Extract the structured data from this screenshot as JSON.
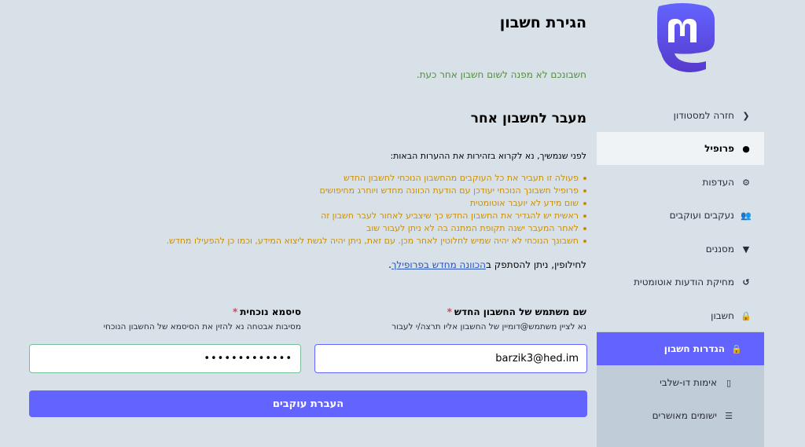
{
  "sidebar": {
    "items": [
      {
        "label": "חזרה למסטודון",
        "icon": "chevron-left-icon",
        "glyph": "❮"
      },
      {
        "label": "פרופיל",
        "icon": "user-icon",
        "glyph": "●"
      },
      {
        "label": "העדפות",
        "icon": "cog-icon",
        "glyph": "⚙"
      },
      {
        "label": "נעקבים ועוקבים",
        "icon": "users-icon",
        "glyph": "👥"
      },
      {
        "label": "מסננים",
        "icon": "filter-icon",
        "glyph": "▼"
      },
      {
        "label": "מחיקת הודעות אוטומטית",
        "icon": "history-icon",
        "glyph": "↺"
      },
      {
        "label": "חשבון",
        "icon": "lock-icon",
        "glyph": "🔒"
      },
      {
        "label": "הגדרות חשבון",
        "icon": "lock-icon",
        "glyph": "🔒"
      },
      {
        "label": "אימות דו-שלבי",
        "icon": "mobile-icon",
        "glyph": "▯"
      },
      {
        "label": "ישומים מאושרים",
        "icon": "list-icon",
        "glyph": "☰"
      }
    ]
  },
  "main": {
    "page_title": "הגירת חשבון",
    "notice": "חשבונכם לא מפנה לשום חשבון אחר כעת.",
    "section_title": "מעבר לחשבון אחר",
    "intro": "לפני שנמשיך, נא לקרוא בזהירות את ההערות הבאות:",
    "warnings": [
      "פעולה זו תעביר את כל העוקבים מהחשבון הנוכחי לחשבון החדש",
      "פרופיל חשבונך הנוכחי יעודכן עם הודעת הכוונה מחדש ויוחרג מחיפושים",
      "שום מידע לא יועבר אוטומטית",
      "ראשית יש להגדיר את החשבון החדש כך שיצביע לאחור לעבר חשבון זה",
      "לאחר המעבר ישנה תקופת המתנה בה לא ניתן לעבור שוב",
      "חשבונך הנוכחי לא יהיה שמיש לחלוטין לאחר מכן. עם זאת, ניתן יהיה לגשת ליצוא המידע, וכמו כן להפעילו מחדש."
    ],
    "alt_prefix": "לחילופין, ניתן להסתפק ב",
    "alt_link": "הכוונה מחדש בפרופילך",
    "alt_suffix": "."
  },
  "form": {
    "handle_label": "שם משתמש של החשבון החדש",
    "handle_hint": "נא לציין משתמש@דומיין של החשבון אליו תרצה/י לעבור",
    "handle_value": "barzik3@hed.im",
    "password_label": "סיסמא נוכחית",
    "password_hint": "מסיבות אבטחה נא להזין את הסיסמא של החשבון הנוכחי",
    "password_value": "•••••••••••••",
    "required_mark": "*",
    "submit_label": "העברת עוקבים"
  },
  "colors": {
    "accent": "#6364ff",
    "warning": "#ca8f04",
    "success": "#4f8f3b",
    "required": "#df405a"
  }
}
